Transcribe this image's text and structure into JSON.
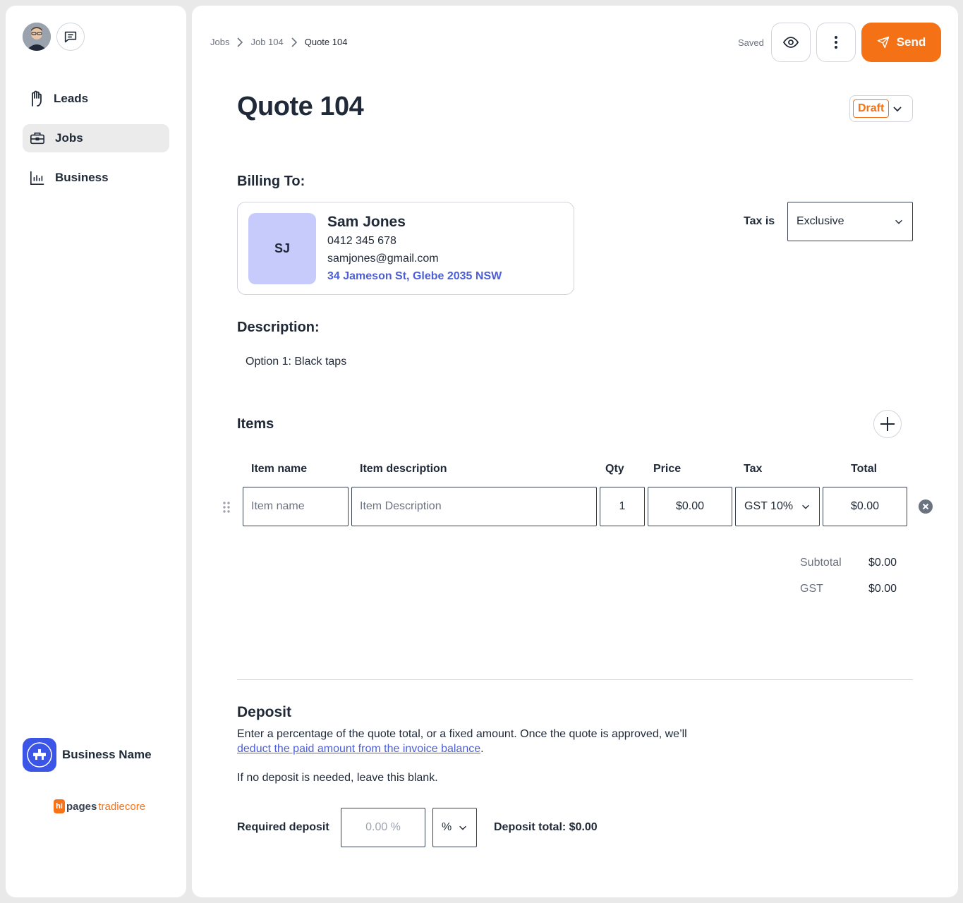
{
  "sidebar": {
    "nav": [
      {
        "label": "Leads",
        "icon": "hand-icon"
      },
      {
        "label": "Jobs",
        "icon": "briefcase-icon"
      },
      {
        "label": "Business",
        "icon": "bar-chart-icon"
      }
    ],
    "business_name": "Business Name",
    "brand": {
      "hi": "hi",
      "pages": "pages",
      "tradiecore": "tradiecore"
    }
  },
  "header": {
    "breadcrumb": [
      "Jobs",
      "Job 104",
      "Quote 104"
    ],
    "saved": "Saved",
    "send_label": "Send"
  },
  "quote": {
    "title": "Quote 104",
    "status": "Draft"
  },
  "billing": {
    "heading": "Billing To:",
    "initials": "SJ",
    "name": "Sam Jones",
    "phone": "0412 345 678",
    "email": "samjones@gmail.com",
    "address": "34 Jameson St, Glebe 2035 NSW"
  },
  "tax": {
    "label": "Tax is",
    "value": "Exclusive"
  },
  "description": {
    "heading": "Description:",
    "text": "Option 1: Black taps"
  },
  "items": {
    "heading": "Items",
    "columns": [
      "Item name",
      "Item description",
      "Qty",
      "Price",
      "Tax",
      "Total"
    ],
    "row": {
      "name_placeholder": "Item name",
      "description_placeholder": "Item Description",
      "qty": "1",
      "price": "$0.00",
      "tax": "GST 10%",
      "total": "$0.00"
    }
  },
  "summary": {
    "subtotal_label": "Subtotal",
    "subtotal": "$0.00",
    "gst_label": "GST",
    "gst": "$0.00"
  },
  "deposit": {
    "heading": "Deposit",
    "text_before": "Enter a percentage of the quote total, or a fixed amount. Once the quote is approved, we’ll ",
    "link": "deduct the paid amount from the invoice balance",
    "text_after": ".",
    "no_deposit": "If no deposit is needed, leave this blank.",
    "required_label": "Required deposit",
    "placeholder": "0.00 %",
    "unit": "%",
    "total": "Deposit total: $0.00"
  },
  "colors": {
    "accent": "#f47215",
    "link": "#4d5fd6",
    "initials_bg": "#c7cbfb"
  }
}
